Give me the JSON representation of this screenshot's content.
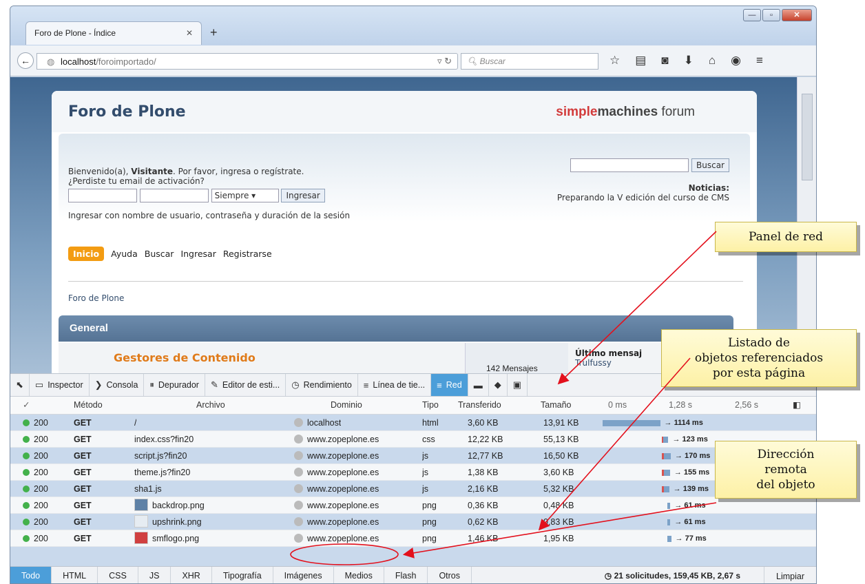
{
  "browser": {
    "tab_title": "Foro de Plone - Índice",
    "url_host": "localhost",
    "url_path": "/foroimportado/",
    "search_placeholder": "Buscar"
  },
  "forum": {
    "title": "Foro de Plone",
    "smf_logo_a": "simple",
    "smf_logo_b": "machines",
    "smf_logo_c": " forum",
    "welcome_a": "Bienvenido(a), ",
    "welcome_b": "Visitante",
    "welcome_c": ". Por favor, ingresa o regístrate.",
    "forgot": "¿Perdiste tu email de activación?",
    "session_select": "Siempre",
    "login_button": "Ingresar",
    "login_hint": "Ingresar con nombre de usuario, contraseña y duración de la sesión",
    "search_button": "Buscar",
    "news_label": "Noticias:",
    "news_text": "Preparando la V edición del curso de CMS",
    "menu": [
      "Inicio",
      "Ayuda",
      "Buscar",
      "Ingresar",
      "Registrarse"
    ],
    "breadcrumb": "Foro de Plone",
    "category": "General",
    "board_name": "Gestores de Contenido",
    "board_posts": "142 Mensajes",
    "last_post_label": "Último mensaj",
    "last_post_user": "Trulfussy"
  },
  "devtools": {
    "tabs": [
      "Inspector",
      "Consola",
      "Depurador",
      "Editor de esti...",
      "Rendimiento",
      "Línea de tie...",
      "Red"
    ],
    "columns": [
      "Método",
      "Archivo",
      "Dominio",
      "Tipo",
      "Transferido",
      "Tamaño"
    ],
    "timeline_ticks": [
      "0 ms",
      "1,28 s",
      "2,56 s"
    ],
    "requests": [
      {
        "status": "200",
        "method": "GET",
        "file": "/",
        "domain": "localhost",
        "type": "html",
        "transferred": "3,60 KB",
        "size": "13,91 KB",
        "time": "→ 1114 ms",
        "start": 0,
        "dur": 1114
      },
      {
        "status": "200",
        "method": "GET",
        "file": "index.css?fin20",
        "domain": "www.zopeplone.es",
        "type": "css",
        "transferred": "12,22 KB",
        "size": "55,13 KB",
        "time": "→ 123 ms",
        "start": 1150,
        "dur": 123
      },
      {
        "status": "200",
        "method": "GET",
        "file": "script.js?fin20",
        "domain": "www.zopeplone.es",
        "type": "js",
        "transferred": "12,77 KB",
        "size": "16,50 KB",
        "time": "→ 170 ms",
        "start": 1150,
        "dur": 170
      },
      {
        "status": "200",
        "method": "GET",
        "file": "theme.js?fin20",
        "domain": "www.zopeplone.es",
        "type": "js",
        "transferred": "1,38 KB",
        "size": "3,60 KB",
        "time": "→ 155 ms",
        "start": 1150,
        "dur": 155
      },
      {
        "status": "200",
        "method": "GET",
        "file": "sha1.js",
        "domain": "www.zopeplone.es",
        "type": "js",
        "transferred": "2,16 KB",
        "size": "5,32 KB",
        "time": "→ 139 ms",
        "start": 1150,
        "dur": 139
      },
      {
        "status": "200",
        "method": "GET",
        "file": "backdrop.png",
        "domain": "www.zopeplone.es",
        "type": "png",
        "transferred": "0,36 KB",
        "size": "0,48 KB",
        "time": "→ 61 ms",
        "start": 1250,
        "dur": 61
      },
      {
        "status": "200",
        "method": "GET",
        "file": "upshrink.png",
        "domain": "www.zopeplone.es",
        "type": "png",
        "transferred": "0,62 KB",
        "size": "0,83 KB",
        "time": "→ 61 ms",
        "start": 1250,
        "dur": 61
      },
      {
        "status": "200",
        "method": "GET",
        "file": "smflogo.png",
        "domain": "www.zopeplone.es",
        "type": "png",
        "transferred": "1,46 KB",
        "size": "1,95 KB",
        "time": "→ 77 ms",
        "start": 1250,
        "dur": 77
      }
    ],
    "filters": [
      "Todo",
      "HTML",
      "CSS",
      "JS",
      "XHR",
      "Tipografía",
      "Imágenes",
      "Medios",
      "Flash",
      "Otros"
    ],
    "summary": "21 solicitudes, 159,45 KB, 2,67 s",
    "clear": "Limpiar"
  },
  "callouts": {
    "network_panel": "Panel de red",
    "objects_list": [
      "Listado de",
      "objetos referenciados",
      "por esta página"
    ],
    "remote_address": [
      "Dirección",
      "remota",
      "del objeto"
    ]
  },
  "colors": {
    "accent": "#4c9ed9",
    "callout_arrow": "#e3101c",
    "status_ok": "#43b14b"
  }
}
